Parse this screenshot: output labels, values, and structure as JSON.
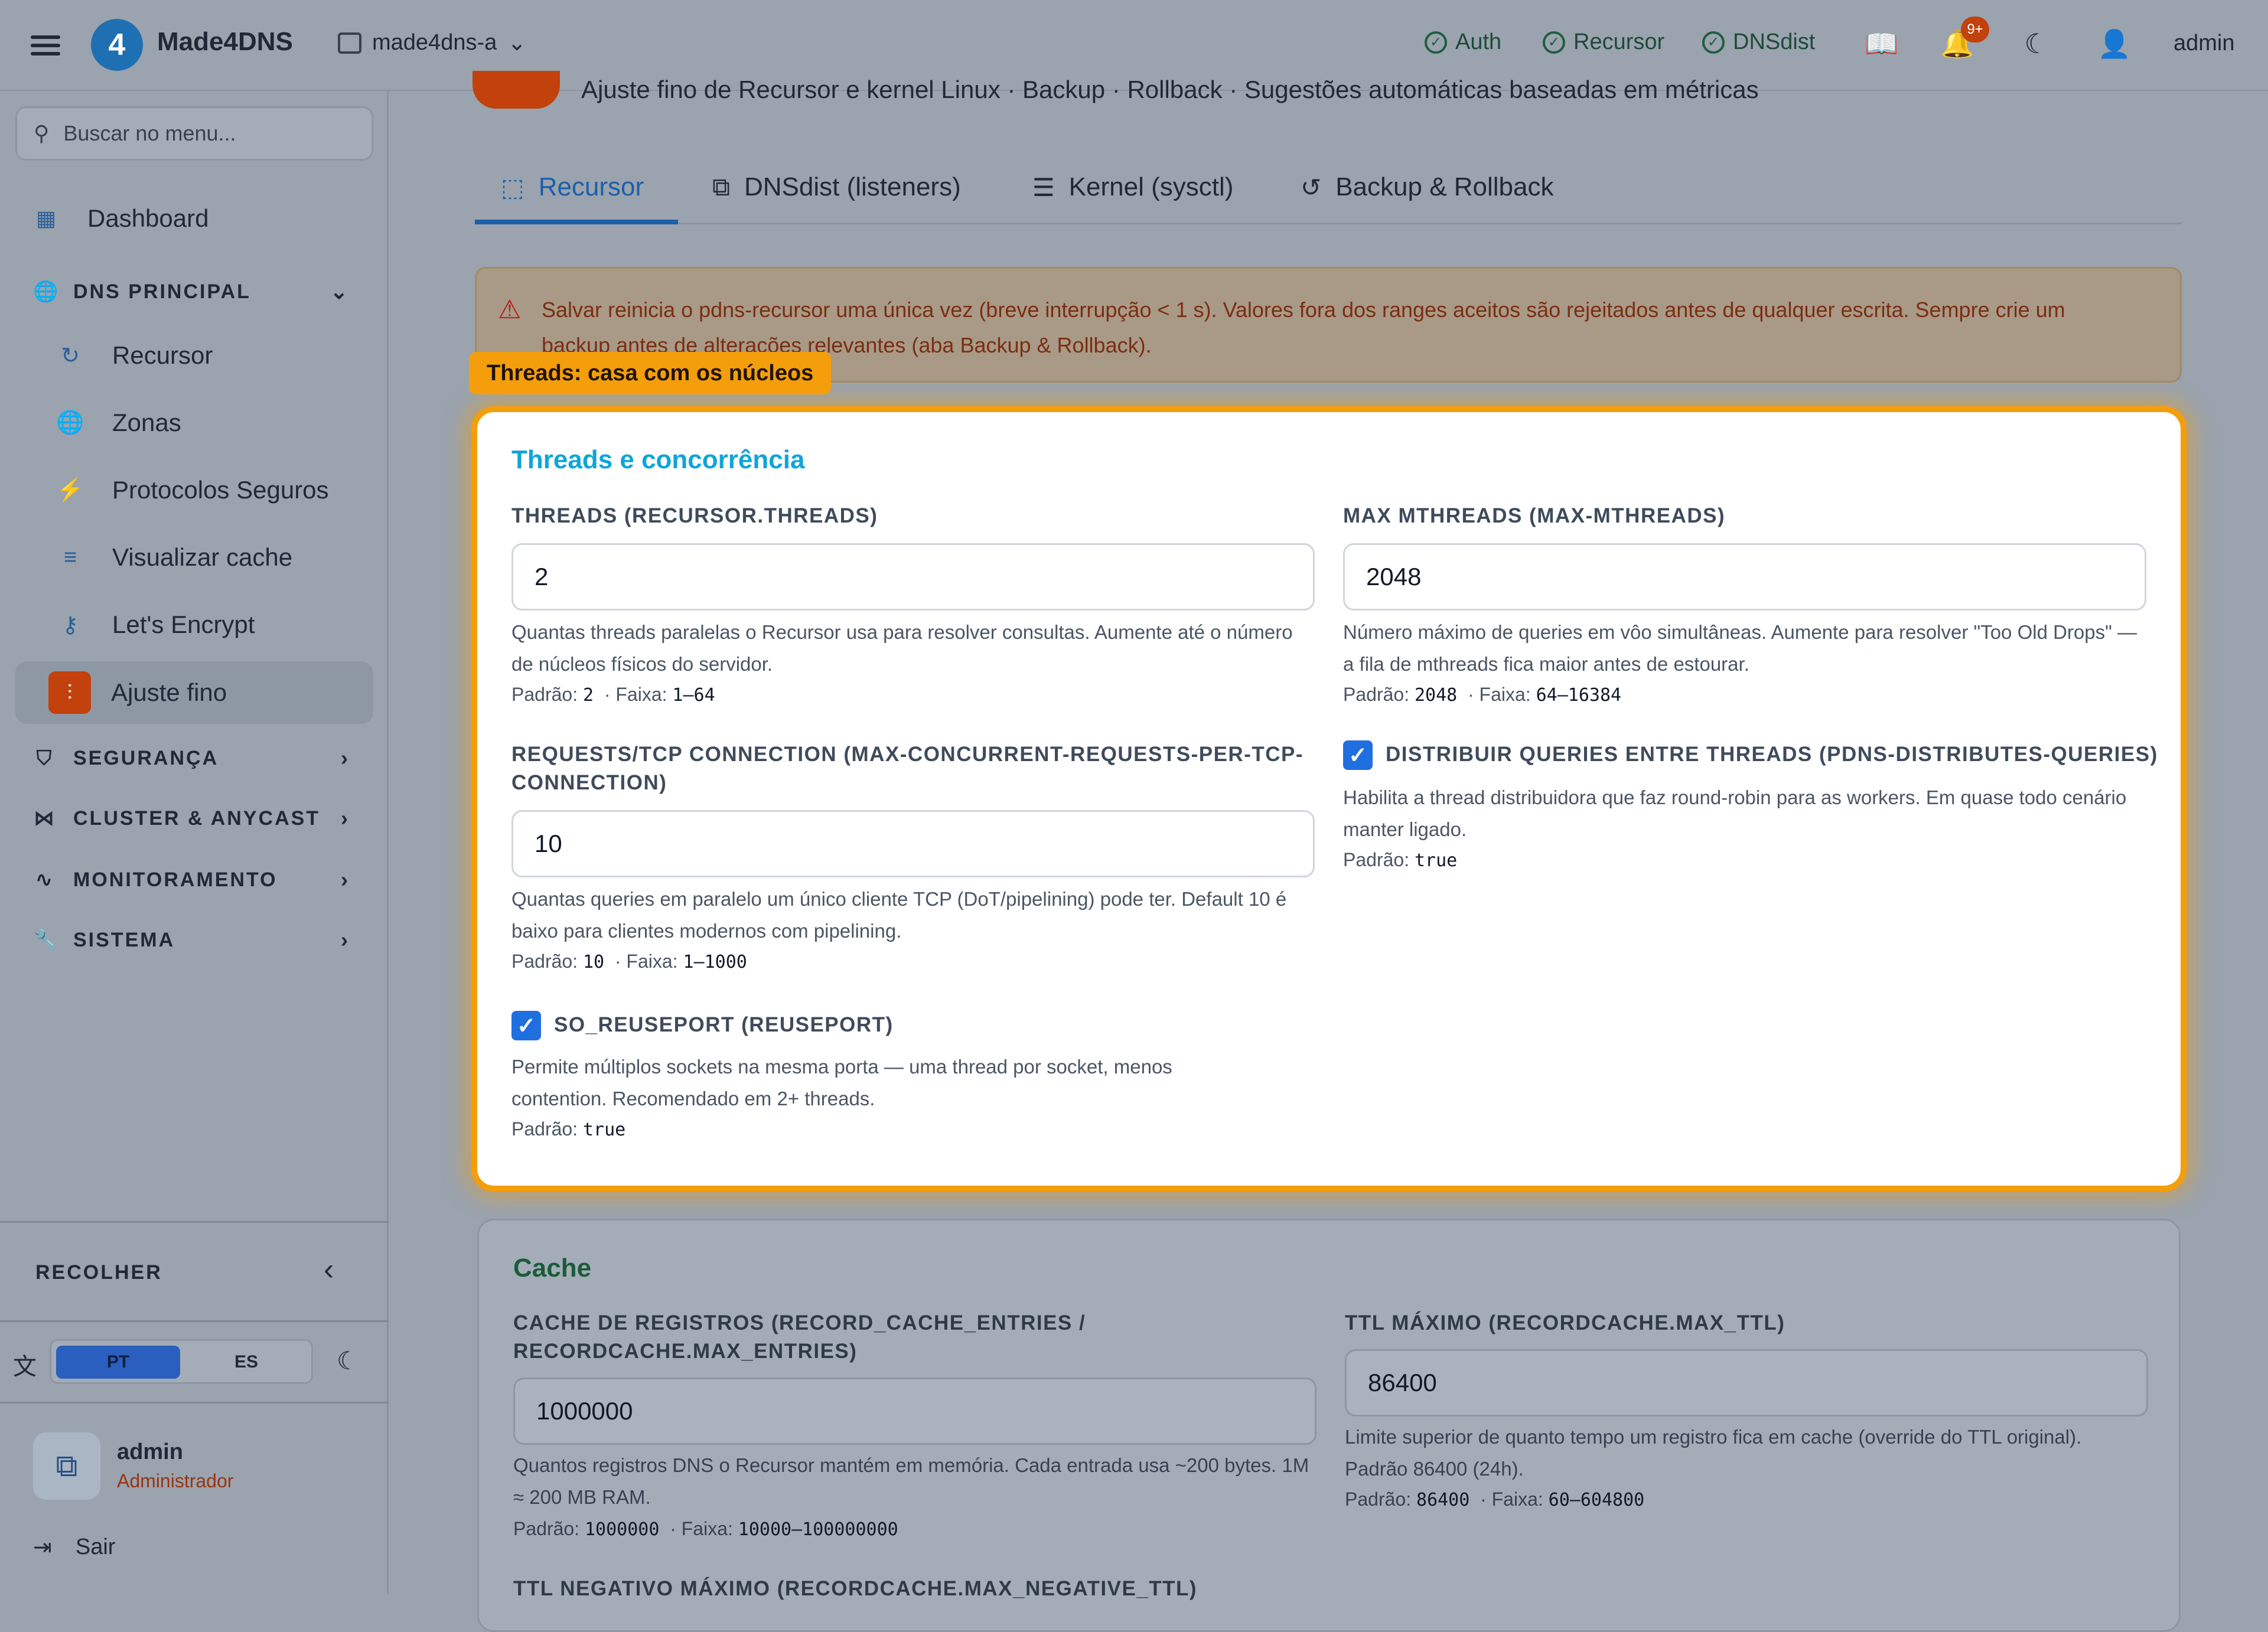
{
  "header": {
    "brand": "Made4DNS",
    "logo_glyph": "4",
    "server": "made4dns-a",
    "statuses": [
      "Auth",
      "Recursor",
      "DNSdist"
    ],
    "notifications_badge": "9+",
    "user": "admin",
    "icons": [
      "menu-icon",
      "server-icon",
      "check-circle-icon",
      "book-icon",
      "bell-icon",
      "moon-icon",
      "user-icon"
    ]
  },
  "sidebar": {
    "search_placeholder": "Buscar no menu...",
    "dashboard": "Dashboard",
    "groups": {
      "dns_principal": "DNS PRINCIPAL",
      "seguranca": "SEGURANÇA",
      "cluster": "CLUSTER & ANYCAST",
      "monitoramento": "MONITORAMENTO",
      "sistema": "SISTEMA"
    },
    "items": [
      "Recursor",
      "Zonas",
      "Protocolos Seguros",
      "Visualizar cache",
      "Let's Encrypt",
      "Ajuste fino"
    ],
    "active_item": "Ajuste fino",
    "collapse_label": "RECOLHER",
    "languages": [
      "PT",
      "ES"
    ],
    "active_language": "PT",
    "user_name": "admin",
    "user_role": "Administrador",
    "logout": "Sair"
  },
  "page": {
    "subtitle": "Ajuste fino de Recursor e kernel Linux · Backup · Rollback · Sugestões automáticas baseadas em métricas",
    "tabs": [
      "Recursor",
      "DNSdist (listeners)",
      "Kernel (sysctl)",
      "Backup & Rollback"
    ],
    "active_tab": "Recursor",
    "alert": "Salvar reinicia o pdns-recursor uma única vez (breve interrupção < 1 s). Valores fora dos ranges aceitos são rejeitados antes de qualquer escrita. Sempre crie um backup antes de alterações relevantes (aba Backup & Rollback).",
    "callout": "Threads: casa com os núcleos"
  },
  "threads_card": {
    "title": "Threads e concorrência",
    "threads": {
      "label": "THREADS (RECURSOR.THREADS)",
      "value": "2",
      "help": "Quantas threads paralelas o Recursor usa para resolver consultas. Aumente até o número de núcleos físicos do servidor.",
      "default_label": "Padrão:",
      "default": "2",
      "range_label": "· Faixa:",
      "range": "1–64"
    },
    "max_mthreads": {
      "label": "MAX MTHREADS (MAX-MTHREADS)",
      "value": "2048",
      "help": "Número máximo de queries em vôo simultâneas. Aumente para resolver \"Too Old Drops\" — a fila de mthreads fica maior antes de estourar.",
      "default_label": "Padrão:",
      "default": "2048",
      "range_label": "· Faixa:",
      "range": "64–16384"
    },
    "requests_tcp": {
      "label": "REQUESTS/TCP CONNECTION (MAX-CONCURRENT-REQUESTS-PER-TCP-CONNECTION)",
      "value": "10",
      "help": "Quantas queries em paralelo um único cliente TCP (DoT/pipelining) pode ter. Default 10 é baixo para clientes modernos com pipelining.",
      "default_label": "Padrão:",
      "default": "10",
      "range_label": "· Faixa:",
      "range": "1–1000"
    },
    "distribute": {
      "label": "DISTRIBUIR QUERIES ENTRE THREADS (PDNS-DISTRIBUTES-QUERIES)",
      "checked": true,
      "help": "Habilita a thread distribuidora que faz round-robin para as workers. Em quase todo cenário manter ligado.",
      "default_label": "Padrão:",
      "default": "true"
    },
    "reuseport": {
      "label": "SO_REUSEPORT (REUSEPORT)",
      "checked": true,
      "help": "Permite múltiplos sockets na mesma porta — uma thread por socket, menos contention. Recomendado em 2+ threads.",
      "default_label": "Padrão:",
      "default": "true"
    }
  },
  "cache_card": {
    "title": "Cache",
    "entries": {
      "label": "CACHE DE REGISTROS (RECORD_CACHE_ENTRIES / RECORDCACHE.MAX_ENTRIES)",
      "value": "1000000",
      "help": "Quantos registros DNS o Recursor mantém em memória. Cada entrada usa ~200 bytes. 1M ≈ 200 MB RAM.",
      "default_label": "Padrão:",
      "default": "1000000",
      "range_label": "· Faixa:",
      "range": "10000–100000000"
    },
    "max_ttl": {
      "label": "TTL MÁXIMO (RECORDCACHE.MAX_TTL)",
      "value": "86400",
      "help": "Limite superior de quanto tempo um registro fica em cache (override do TTL original). Padrão 86400 (24h).",
      "default_label": "Padrão:",
      "default": "86400",
      "range_label": "· Faixa:",
      "range": "60–604800"
    },
    "negative_ttl_label": "TTL NEGATIVO MÁXIMO (RECORDCACHE.MAX_NEGATIVE_TTL)"
  }
}
